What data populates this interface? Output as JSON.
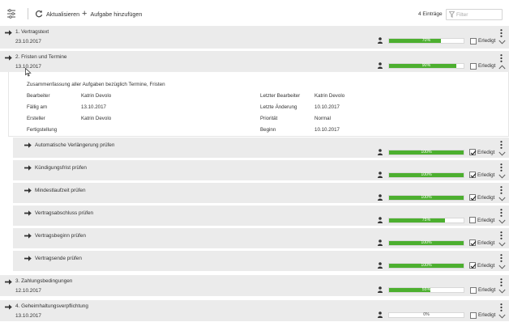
{
  "toolbar": {
    "settings_icon": "list-settings-icon",
    "refresh_icon": "refresh-icon",
    "refresh_label": "Aktualisieren",
    "add_icon": "plus-icon",
    "add_label": "Aufgabe hinzufügen",
    "count": "4 Einträge",
    "filter_icon": "filter-icon",
    "filter_placeholder": "Filter"
  },
  "colors": {
    "progress": "#4caf2f",
    "row_bg": "#ebebeb"
  },
  "tasks": [
    {
      "title": "1. Vertragstext",
      "date": "23.10.2017",
      "progress": 70,
      "progress_label": "70%",
      "done": false,
      "done_label": "Erledigt",
      "expanded": false
    },
    {
      "title": "2. Fristen und Termine",
      "date": "13.10.2017",
      "progress": 90,
      "progress_label": "90%",
      "done": false,
      "done_label": "Erledigt",
      "expanded": true,
      "details": {
        "summary": "Zusammenfassung aller Aufgaben bezüglich Termine, Fristen",
        "left": [
          {
            "label": "Bearbeiter",
            "value": "Katrin Devolo"
          },
          {
            "label": "Fällig am",
            "value": "13.10.2017"
          },
          {
            "label": "Ersteller",
            "value": "Katrin Devolo"
          },
          {
            "label": "Fertigstellung",
            "value": ""
          }
        ],
        "right": [
          {
            "label": "Letzter Bearbeiter",
            "value": "Katrin Devolo"
          },
          {
            "label": "Letzte Änderung",
            "value": "10.10.2017"
          },
          {
            "label": "Priorität",
            "value": "Normal"
          },
          {
            "label": "Beginn",
            "value": "10.10.2017"
          }
        ]
      },
      "subtasks": [
        {
          "title": "Automatische Verlängerung prüfen",
          "progress": 100,
          "progress_label": "100%",
          "done": true,
          "done_label": "Erledigt"
        },
        {
          "title": "Kündigungsfrist prüfen",
          "progress": 100,
          "progress_label": "100%",
          "done": true,
          "done_label": "Erledigt"
        },
        {
          "title": "Mindestlaufzeit prüfen",
          "progress": 100,
          "progress_label": "100%",
          "done": true,
          "done_label": "Erledigt"
        },
        {
          "title": "Vertragsabschluss prüfen",
          "progress": 75,
          "progress_label": "75%",
          "done": false,
          "done_label": "Erledigt"
        },
        {
          "title": "Vertragsbeginn prüfen",
          "progress": 100,
          "progress_label": "100%",
          "done": true,
          "done_label": "Erledigt"
        },
        {
          "title": "Vertragsende prüfen",
          "progress": 100,
          "progress_label": "100%",
          "done": true,
          "done_label": "Erledigt"
        }
      ]
    },
    {
      "title": "3. Zahlungsbedingungen",
      "date": "12.10.2017",
      "progress": 55,
      "progress_label": "55%",
      "done": false,
      "done_label": "Erledigt",
      "expanded": false
    },
    {
      "title": "4. Geheimhaltungsverpflichtung",
      "date": "13.10.2017",
      "progress": 0,
      "progress_label": "0%",
      "done": false,
      "done_label": "Erledigt",
      "expanded": false
    }
  ]
}
